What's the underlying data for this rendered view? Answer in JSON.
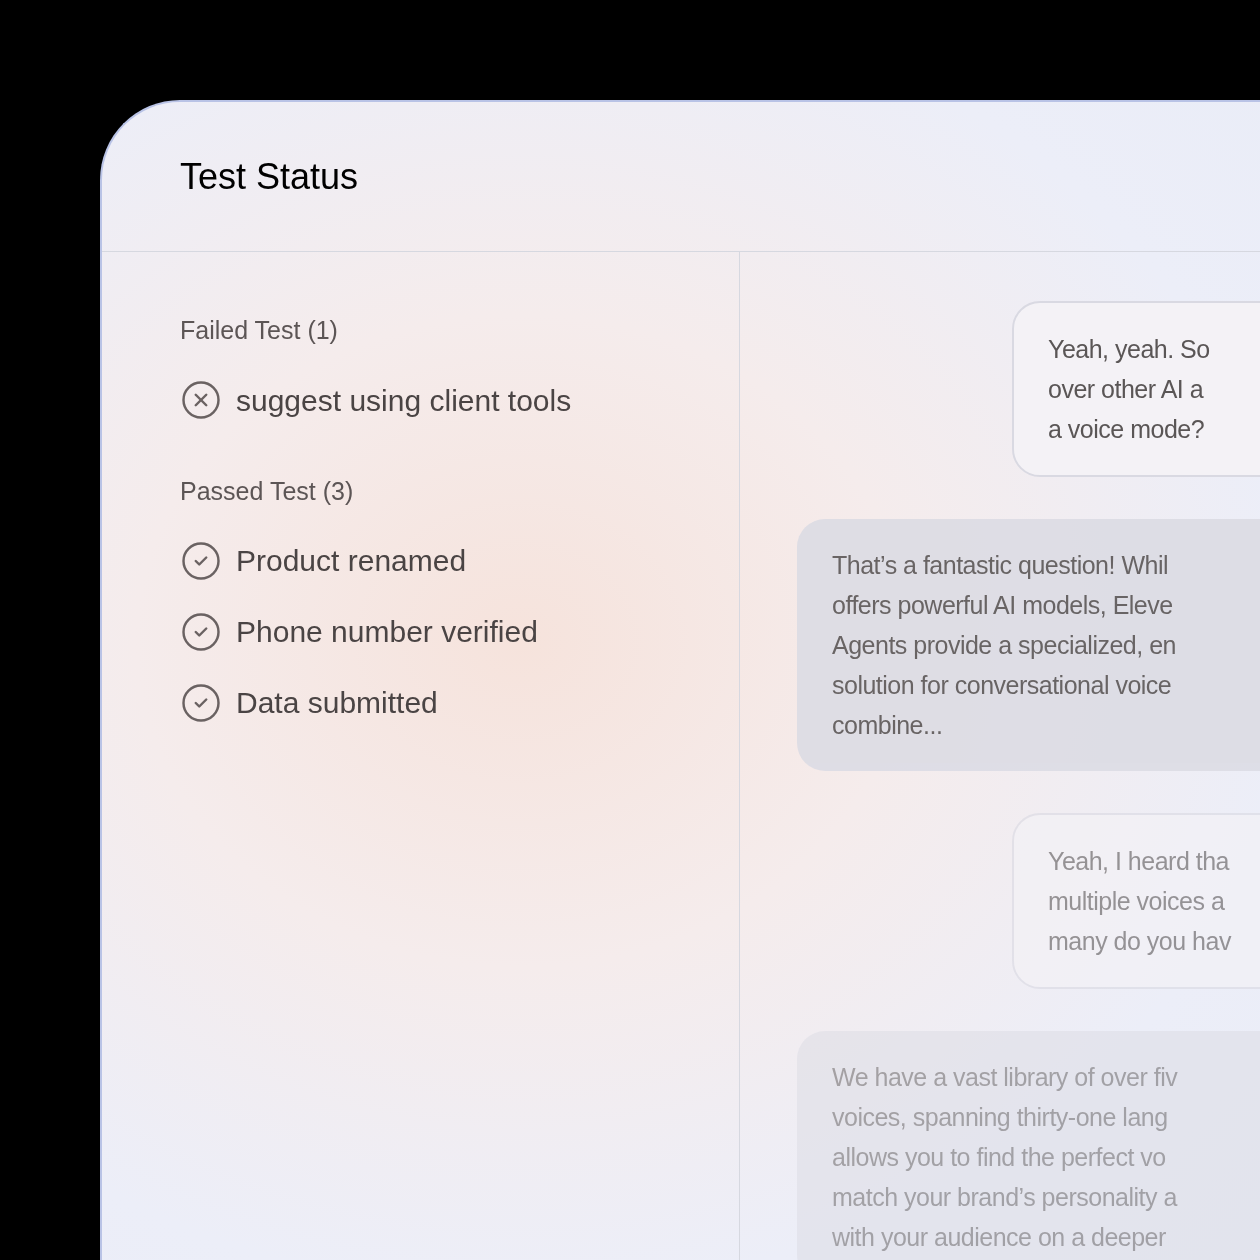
{
  "panel": {
    "title": "Test Status"
  },
  "groups": [
    {
      "heading": "Failed Test (1)",
      "kind": "failed",
      "tests": [
        "suggest using client tools"
      ]
    },
    {
      "heading": "Passed Test (3)",
      "kind": "passed",
      "tests": [
        "Product renamed",
        "Phone number verified",
        "Data submitted"
      ]
    }
  ],
  "messages": [
    {
      "kind": "user",
      "lines": [
        "Yeah, yeah. So",
        "over other AI a",
        "a voice mode?"
      ]
    },
    {
      "kind": "agent",
      "lines": [
        "That’s a fantastic question! Whil",
        "offers powerful AI models, Eleve",
        "Agents provide a specialized, en",
        "solution for conversational voice",
        "combine..."
      ]
    },
    {
      "kind": "user",
      "lines": [
        "Yeah, I heard tha",
        "multiple voices a",
        "many do you hav"
      ]
    },
    {
      "kind": "agent",
      "lines": [
        "We have a vast library of over fiv",
        "voices, spanning thirty-one lang",
        "allows you to find the perfect vo",
        "match your brand’s personality a",
        "with your audience on a deeper"
      ]
    }
  ]
}
